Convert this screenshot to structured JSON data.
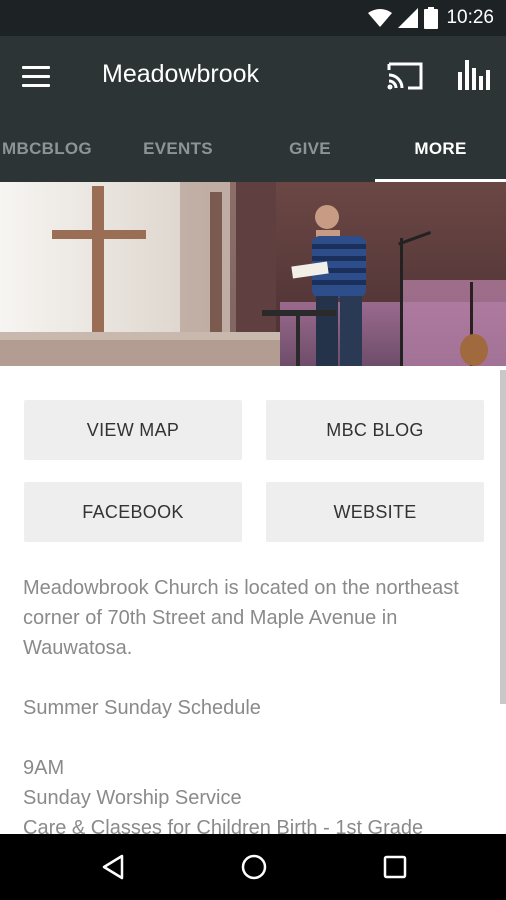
{
  "status_bar": {
    "time": "10:26"
  },
  "app_bar": {
    "title": "Meadowbrook"
  },
  "tabs": [
    {
      "label": "MBCBLOG"
    },
    {
      "label": "EVENTS"
    },
    {
      "label": "GIVE"
    },
    {
      "label": "MORE"
    }
  ],
  "active_tab": "MORE",
  "buttons": {
    "view_map": "VIEW MAP",
    "mbc_blog": "MBC BLOG",
    "facebook": "FACEBOOK",
    "website": "WEBSITE"
  },
  "description": {
    "intro": "Meadowbrook Church is located on the northeast corner of 70th Street and Maple Avenue in Wauwatosa.",
    "schedule_heading": "Summer Sunday Schedule",
    "time": "9AM",
    "service": "Sunday Worship Service",
    "classes": "Care & Classes for Children Birth - 1st Grade"
  },
  "colors": {
    "status_bar": "#1d2224",
    "app_bar": "#2c3436",
    "tab_inactive": "#8c9496",
    "tab_active": "#ffffff",
    "button_bg": "#eeeeee",
    "body_text": "#8a8a8a"
  },
  "icons": {
    "menu": "menu-icon",
    "cast": "cast-icon",
    "stats": "bar-chart-icon",
    "wifi": "wifi-icon",
    "signal": "signal-icon",
    "battery": "battery-icon",
    "back": "back-icon",
    "home": "home-icon",
    "recents": "recents-icon"
  }
}
